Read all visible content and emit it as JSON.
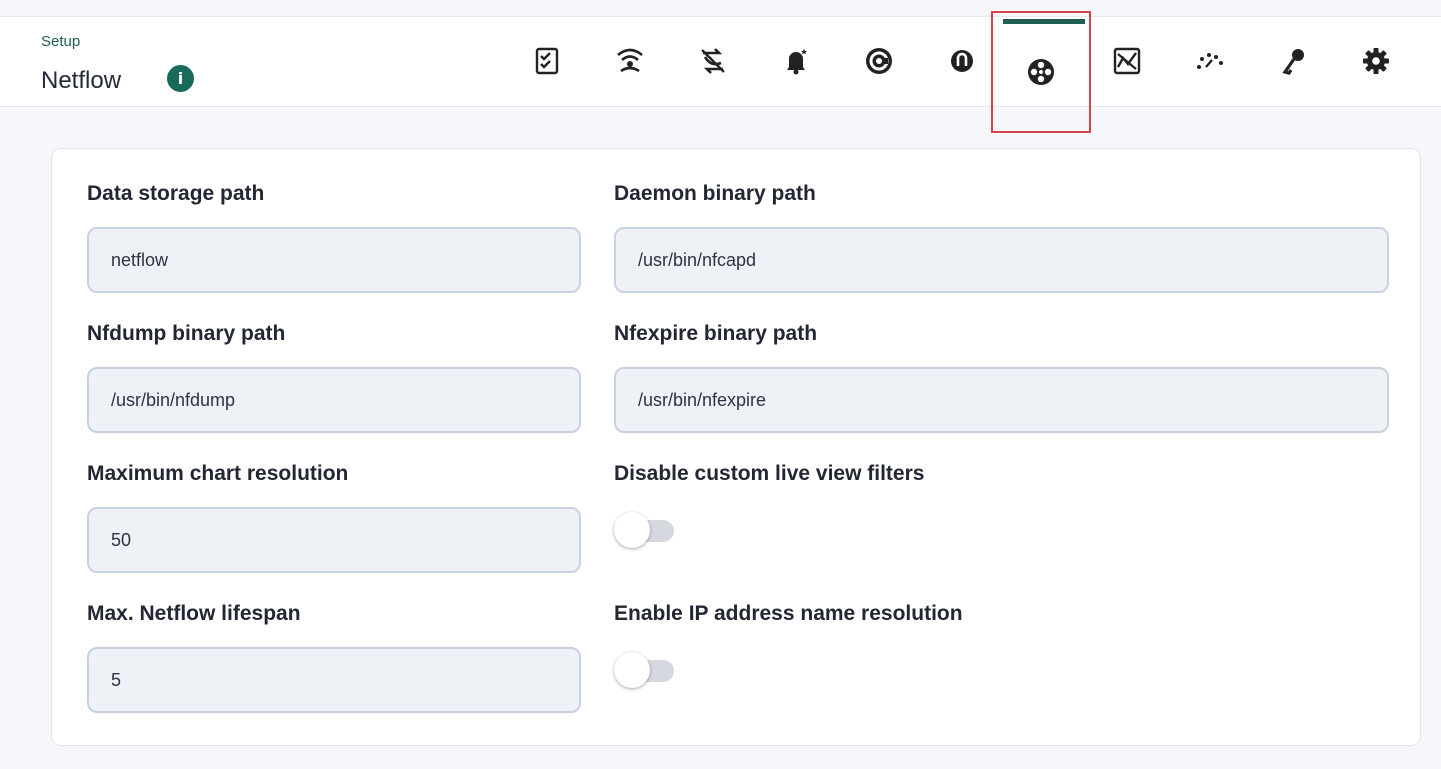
{
  "header": {
    "breadcrumb": "Setup",
    "title": "Netflow",
    "info_icon": "info-icon",
    "tabs": [
      {
        "icon": "checklist-icon"
      },
      {
        "icon": "wifi-icon"
      },
      {
        "icon": "transfer-icon"
      },
      {
        "icon": "bell-icon"
      },
      {
        "icon": "logo-c-icon"
      },
      {
        "icon": "logo-circle-icon"
      },
      {
        "icon": "netflow-icon",
        "active": true
      },
      {
        "icon": "chart-icon"
      },
      {
        "icon": "gauge-icon"
      },
      {
        "icon": "key-icon"
      },
      {
        "icon": "gear-icon"
      }
    ]
  },
  "form": {
    "data_storage_path": {
      "label": "Data storage path",
      "value": "netflow"
    },
    "daemon_binary_path": {
      "label": "Daemon binary path",
      "value": "/usr/bin/nfcapd"
    },
    "nfdump_binary_path": {
      "label": "Nfdump binary path",
      "value": "/usr/bin/nfdump"
    },
    "nfexpire_binary_path": {
      "label": "Nfexpire binary path",
      "value": "/usr/bin/nfexpire"
    },
    "max_chart_resolution": {
      "label": "Maximum chart resolution",
      "value": "50"
    },
    "disable_live_view_filters": {
      "label": "Disable custom live view filters",
      "enabled": false
    },
    "max_netflow_lifespan": {
      "label": "Max. Netflow lifespan",
      "value": "5"
    },
    "enable_ip_name_resolution": {
      "label": "Enable IP address name resolution",
      "enabled": false
    }
  },
  "colors": {
    "accent": "#1e5e52",
    "active_tab_outline": "#d6454a",
    "input_bg": "#eef1f6",
    "input_border": "#c8d1e0"
  }
}
